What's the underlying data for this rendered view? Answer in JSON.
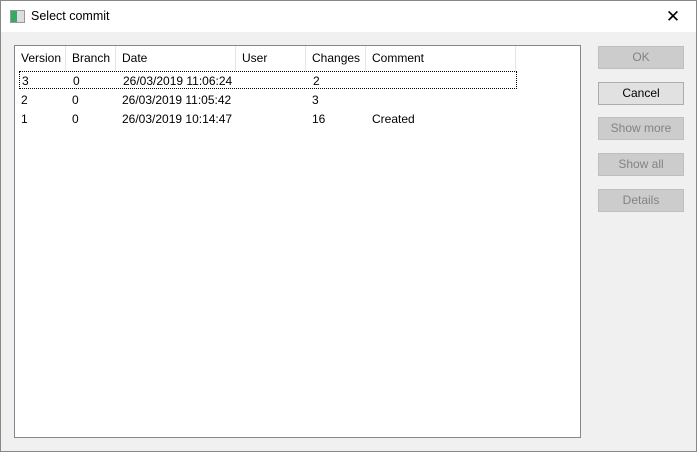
{
  "window": {
    "title": "Select commit",
    "close": "✕"
  },
  "table": {
    "columns": [
      "Version",
      "Branch",
      "Date",
      "User",
      "Changes",
      "Comment"
    ],
    "rows": [
      [
        "3",
        "0",
        "26/03/2019 11:06:24",
        "",
        "2",
        ""
      ],
      [
        "2",
        "0",
        "26/03/2019 11:05:42",
        "",
        "3",
        ""
      ],
      [
        "1",
        "0",
        "26/03/2019 10:14:47",
        "",
        "16",
        "Created"
      ]
    ]
  },
  "buttons": {
    "ok": "OK",
    "cancel": "Cancel",
    "show_more": "Show more",
    "show_all": "Show all",
    "details": "Details"
  }
}
